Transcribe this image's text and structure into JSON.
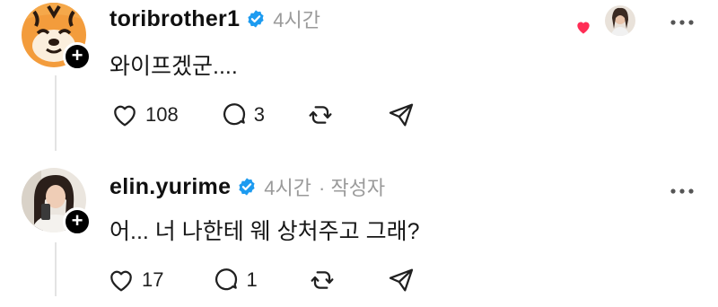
{
  "posts": [
    {
      "username": "toribrother1",
      "time": "4시간",
      "author_tag": "",
      "text": "와이프겠군....",
      "likes": "108",
      "replies": "3",
      "avatar_icon": "tiger-icon"
    },
    {
      "username": "elin.yurime",
      "time": "4시간",
      "author_tag": "· 작성자",
      "text": "어... 너 나한테 웨 상처주고 그래?",
      "likes": "17",
      "replies": "1",
      "avatar_icon": "user-photo"
    }
  ],
  "colors": {
    "verified": "#1d9bf0",
    "liked_heart": "#ff2d55",
    "thread_line": "#e3e3e3",
    "meta_text": "#9a9a9a"
  }
}
